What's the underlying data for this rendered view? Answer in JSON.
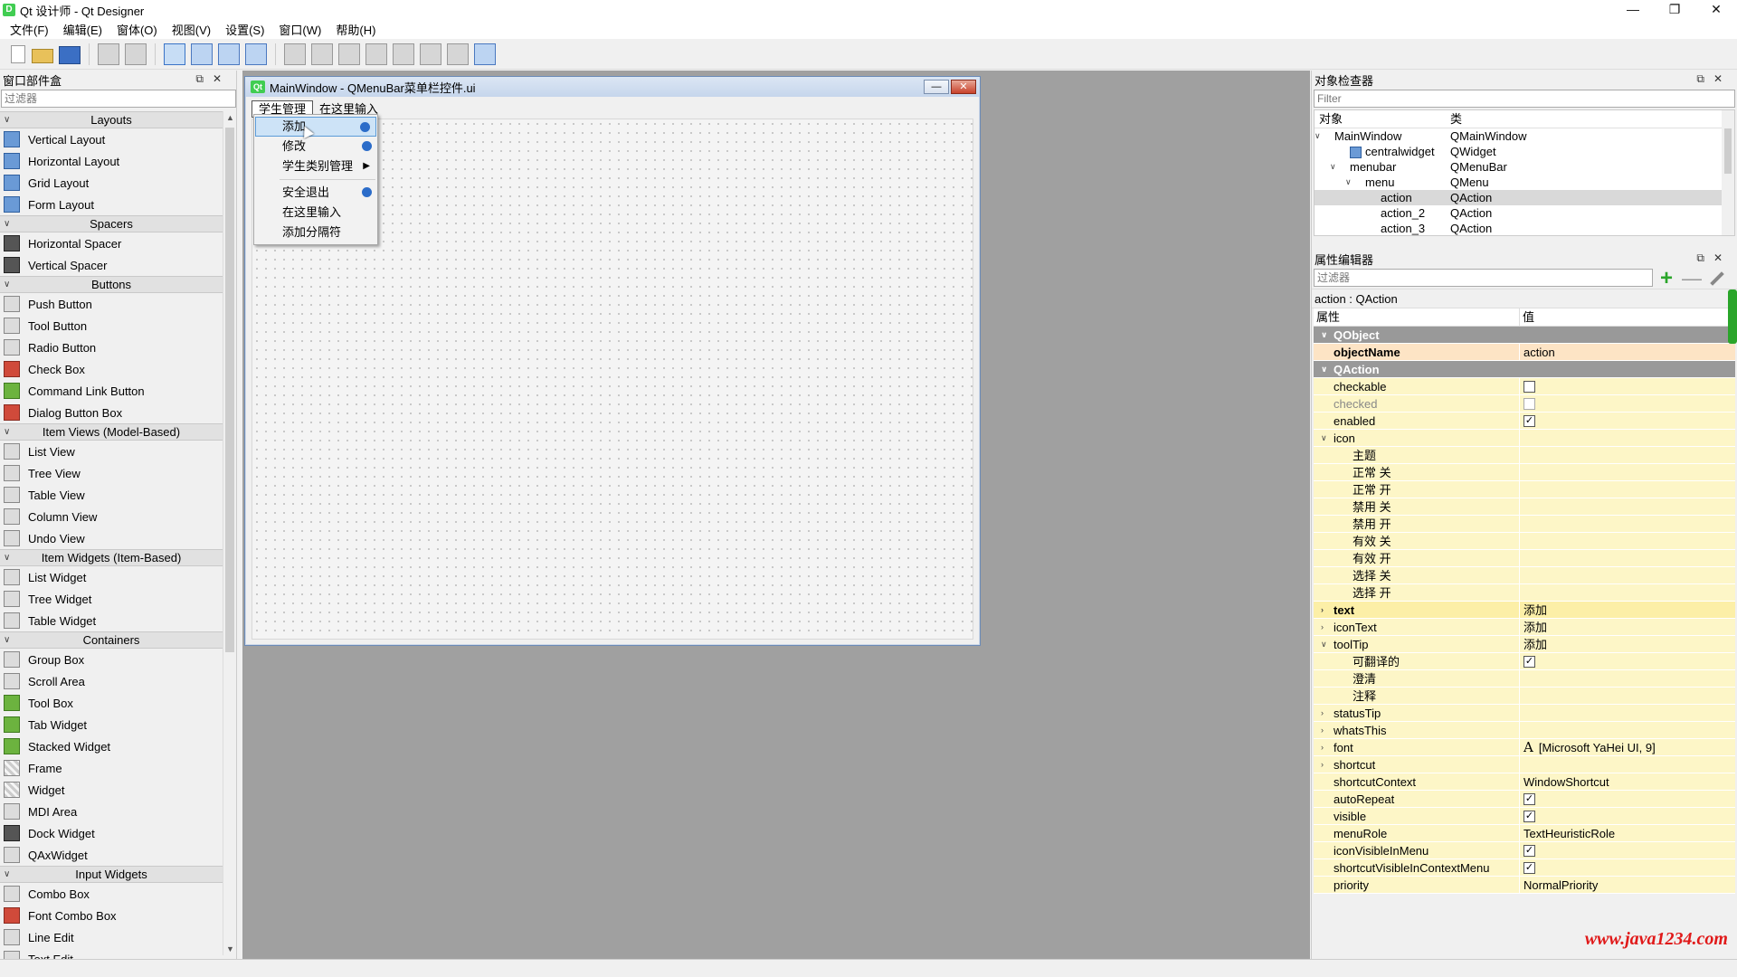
{
  "window": {
    "title": "Qt 设计师 - Qt Designer",
    "app_icon_letter": "D",
    "controls": [
      "—",
      "❐",
      "✕"
    ]
  },
  "menubar": [
    "文件(F)",
    "编辑(E)",
    "窗体(O)",
    "视图(V)",
    "设置(S)",
    "窗口(W)",
    "帮助(H)"
  ],
  "widget_box": {
    "title": "窗口部件盒",
    "filter_placeholder": "过滤器",
    "sections": [
      {
        "name": "Layouts",
        "items": [
          "Vertical Layout",
          "Horizontal Layout",
          "Grid Layout",
          "Form Layout"
        ]
      },
      {
        "name": "Spacers",
        "items": [
          "Horizontal Spacer",
          "Vertical Spacer"
        ]
      },
      {
        "name": "Buttons",
        "items": [
          "Push Button",
          "Tool Button",
          "Radio Button",
          "Check Box",
          "Command Link Button",
          "Dialog Button Box"
        ]
      },
      {
        "name": "Item Views (Model-Based)",
        "items": [
          "List View",
          "Tree View",
          "Table View",
          "Column View",
          "Undo View"
        ]
      },
      {
        "name": "Item Widgets (Item-Based)",
        "items": [
          "List Widget",
          "Tree Widget",
          "Table Widget"
        ]
      },
      {
        "name": "Containers",
        "items": [
          "Group Box",
          "Scroll Area",
          "Tool Box",
          "Tab Widget",
          "Stacked Widget",
          "Frame",
          "Widget",
          "MDI Area",
          "Dock Widget",
          "QAxWidget"
        ]
      },
      {
        "name": "Input Widgets",
        "items": [
          "Combo Box",
          "Font Combo Box",
          "Line Edit",
          "Text Edit"
        ]
      }
    ]
  },
  "form": {
    "title": "MainWindow - QMenuBar菜单栏控件.ui",
    "qt_badge": "Qt",
    "menu_titles": [
      "学生管理",
      "在这里输入"
    ],
    "popup_items": [
      {
        "label": "添加",
        "highlighted": true,
        "has_action_icon": true,
        "has_submenu": false
      },
      {
        "label": "修改",
        "highlighted": false,
        "has_action_icon": true,
        "has_submenu": false
      },
      {
        "label": "学生类别管理",
        "highlighted": false,
        "has_action_icon": false,
        "has_submenu": true
      },
      {
        "separator": true
      },
      {
        "label": "安全退出",
        "highlighted": false,
        "has_action_icon": true,
        "has_submenu": false
      },
      {
        "label": "在这里输入",
        "highlighted": false,
        "has_action_icon": false,
        "has_submenu": false
      },
      {
        "label": "添加分隔符",
        "highlighted": false,
        "has_action_icon": false,
        "has_submenu": false
      }
    ]
  },
  "object_inspector": {
    "title": "对象检查器",
    "filter_placeholder": "Filter",
    "col_object": "对象",
    "col_class": "类",
    "rows": [
      {
        "object": "MainWindow",
        "class": "QMainWindow",
        "level": 0,
        "expanded": true,
        "selected": false
      },
      {
        "object": "centralwidget",
        "class": "QWidget",
        "level": 1,
        "expanded": null,
        "selected": false
      },
      {
        "object": "menubar",
        "class": "QMenuBar",
        "level": 1,
        "expanded": true,
        "selected": false
      },
      {
        "object": "menu",
        "class": "QMenu",
        "level": 2,
        "expanded": true,
        "selected": false
      },
      {
        "object": "action",
        "class": "QAction",
        "level": 3,
        "expanded": null,
        "selected": true
      },
      {
        "object": "action_2",
        "class": "QAction",
        "level": 3,
        "expanded": null,
        "selected": false
      },
      {
        "object": "action_3",
        "class": "QAction",
        "level": 3,
        "expanded": null,
        "selected": false
      }
    ]
  },
  "property_editor": {
    "title": "属性编辑器",
    "filter_placeholder": "过滤器",
    "caption": "action : QAction",
    "col_property": "属性",
    "col_value": "值",
    "rows": [
      {
        "name": "QObject",
        "kind": "group",
        "expand": "v"
      },
      {
        "name": "objectName",
        "value": "action",
        "kind": "org"
      },
      {
        "name": "QAction",
        "kind": "group",
        "expand": "v"
      },
      {
        "name": "checkable",
        "kind": "yel",
        "check": false
      },
      {
        "name": "checked",
        "kind": "yel",
        "check": false,
        "disabled": true
      },
      {
        "name": "enabled",
        "kind": "yel",
        "check": true
      },
      {
        "name": "icon",
        "kind": "yel",
        "expand": "v"
      },
      {
        "name": "主题",
        "kind": "yel",
        "sub": true
      },
      {
        "name": "正常 关",
        "kind": "yel",
        "sub": true
      },
      {
        "name": "正常 开",
        "kind": "yel",
        "sub": true
      },
      {
        "name": "禁用 关",
        "kind": "yel",
        "sub": true
      },
      {
        "name": "禁用 开",
        "kind": "yel",
        "sub": true
      },
      {
        "name": "有效 关",
        "kind": "yel",
        "sub": true
      },
      {
        "name": "有效 开",
        "kind": "yel",
        "sub": true
      },
      {
        "name": "选择 关",
        "kind": "yel",
        "sub": true
      },
      {
        "name": "选择 开",
        "kind": "yel",
        "sub": true
      },
      {
        "name": "text",
        "value": "添加",
        "kind": "yel2",
        "bold": true,
        "expand": ">"
      },
      {
        "name": "iconText",
        "value": "添加",
        "kind": "yel",
        "expand": ">"
      },
      {
        "name": "toolTip",
        "value": "添加",
        "kind": "yel",
        "expand": "v"
      },
      {
        "name": "可翻译的",
        "kind": "yel",
        "sub": true,
        "check": true
      },
      {
        "name": "澄清",
        "kind": "yel",
        "sub": true
      },
      {
        "name": "注释",
        "kind": "yel",
        "sub": true
      },
      {
        "name": "statusTip",
        "kind": "yel",
        "expand": ">"
      },
      {
        "name": "whatsThis",
        "kind": "yel",
        "expand": ">"
      },
      {
        "name": "font",
        "value": "[Microsoft YaHei UI, 9]",
        "kind": "yel",
        "expand": ">",
        "font_icon": "A"
      },
      {
        "name": "shortcut",
        "kind": "yel",
        "expand": ">"
      },
      {
        "name": "shortcutContext",
        "value": "WindowShortcut",
        "kind": "yel"
      },
      {
        "name": "autoRepeat",
        "kind": "yel",
        "check": true
      },
      {
        "name": "visible",
        "kind": "yel",
        "check": true
      },
      {
        "name": "menuRole",
        "value": "TextHeuristicRole",
        "kind": "yel"
      },
      {
        "name": "iconVisibleInMenu",
        "kind": "yel",
        "check": true
      },
      {
        "name": "shortcutVisibleInContextMenu",
        "kind": "yel",
        "check": true
      },
      {
        "name": "priority",
        "value": "NormalPriority",
        "kind": "yel"
      }
    ]
  },
  "watermark": "www.java1234.com",
  "colors": {
    "accent": "#41cd52",
    "group_header": "#999999",
    "property_yellow": "#fdf6c7",
    "property_orange": "#fde4c5",
    "menu_highlight": "#cde3f7",
    "watermark": "#e01919"
  }
}
